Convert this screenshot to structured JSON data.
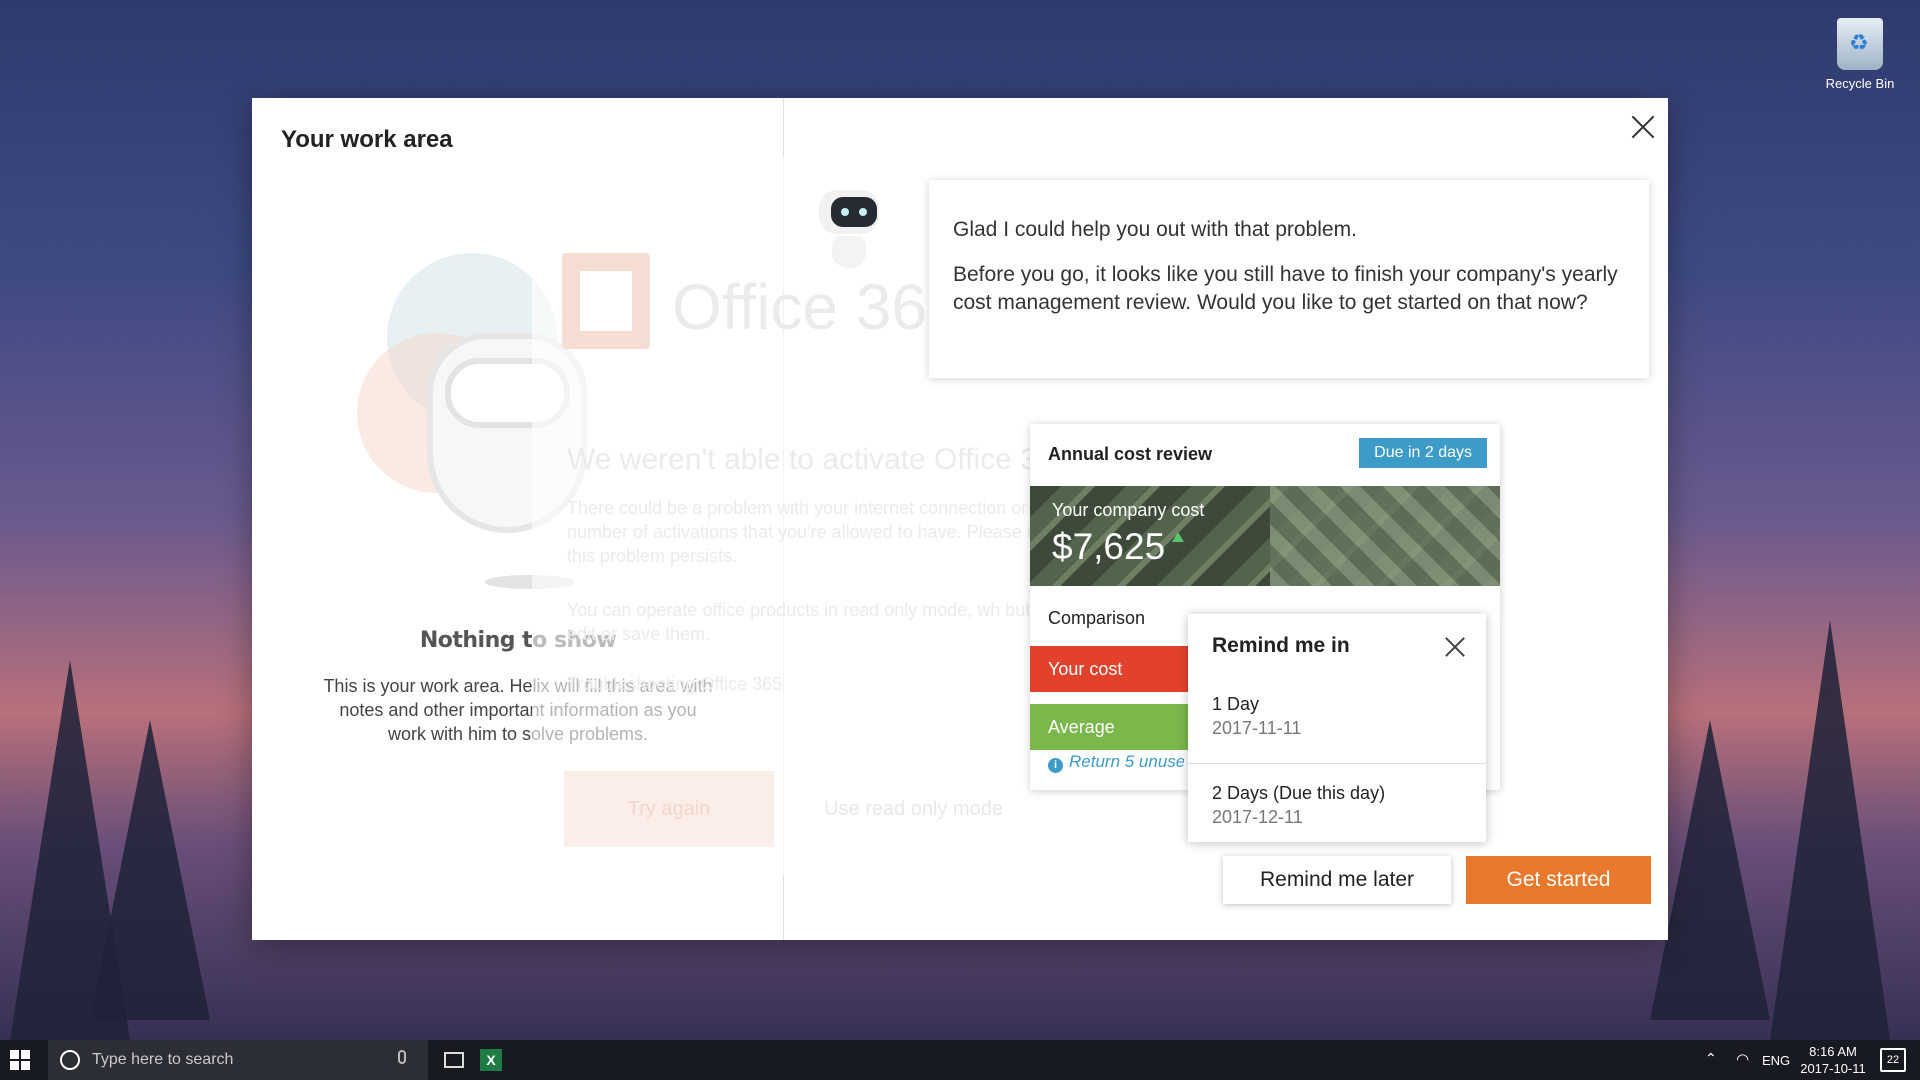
{
  "desktop": {
    "recycle_bin_label": "Recycle Bin"
  },
  "work_area": {
    "title": "Your work area",
    "empty_title": "Nothing to show",
    "empty_text": "This is your work area. Helix will fill this area with notes and other important information as you work with him to solve problems."
  },
  "background": {
    "logo_text": "Office 365",
    "headline": "We weren't able to activate Office 365",
    "para1": "There could be a problem with your internet connection or the number of activations that you're allowed to have. Please if this problem persists.",
    "para2": "You can operate office products in read only mode, wh but not edit or save them.",
    "para3": "Troubleshooting Office 365",
    "try_again": "Try again",
    "read_only": "Use read only mode"
  },
  "chat": {
    "message1": "Glad I could help you out with that problem.",
    "message2": "Before you go, it looks like you still have to finish your company's yearly cost management review. Would you like to get started on that now?"
  },
  "cost_card": {
    "title": "Annual cost review",
    "due_badge": "Due in 2 days",
    "company_cost_label": "Your company cost",
    "company_cost_value": "$7,625",
    "comparison_label": "Comparison",
    "your_cost_label": "Your cost",
    "average_label": "Average",
    "return_link": "Return 5 unused"
  },
  "remind_popover": {
    "title": "Remind me in",
    "options": [
      {
        "label": "1 Day",
        "date": "2017-11-11"
      },
      {
        "label": "2 Days (Due this day)",
        "date": "2017-12-11"
      }
    ]
  },
  "actions": {
    "remind_later": "Remind me later",
    "get_started": "Get started"
  },
  "taskbar": {
    "search_placeholder": "Type here to search",
    "language": "ENG",
    "time": "8:16 AM",
    "date": "2017-10-11",
    "notification_count": "22"
  },
  "colors": {
    "accent_orange": "#e8782b",
    "badge_blue": "#3c9bc7",
    "your_cost_red": "#e2412b",
    "average_green": "#7bb84c"
  },
  "icons": {
    "close": "close-icon",
    "recycle_bin": "recycle-bin-icon",
    "info": "info-icon",
    "windows": "windows-logo-icon",
    "cortana": "cortana-icon",
    "microphone": "microphone-icon",
    "task_view": "task-view-icon",
    "excel": "excel-icon",
    "wifi": "wifi-icon",
    "notifications": "notification-center-icon"
  }
}
